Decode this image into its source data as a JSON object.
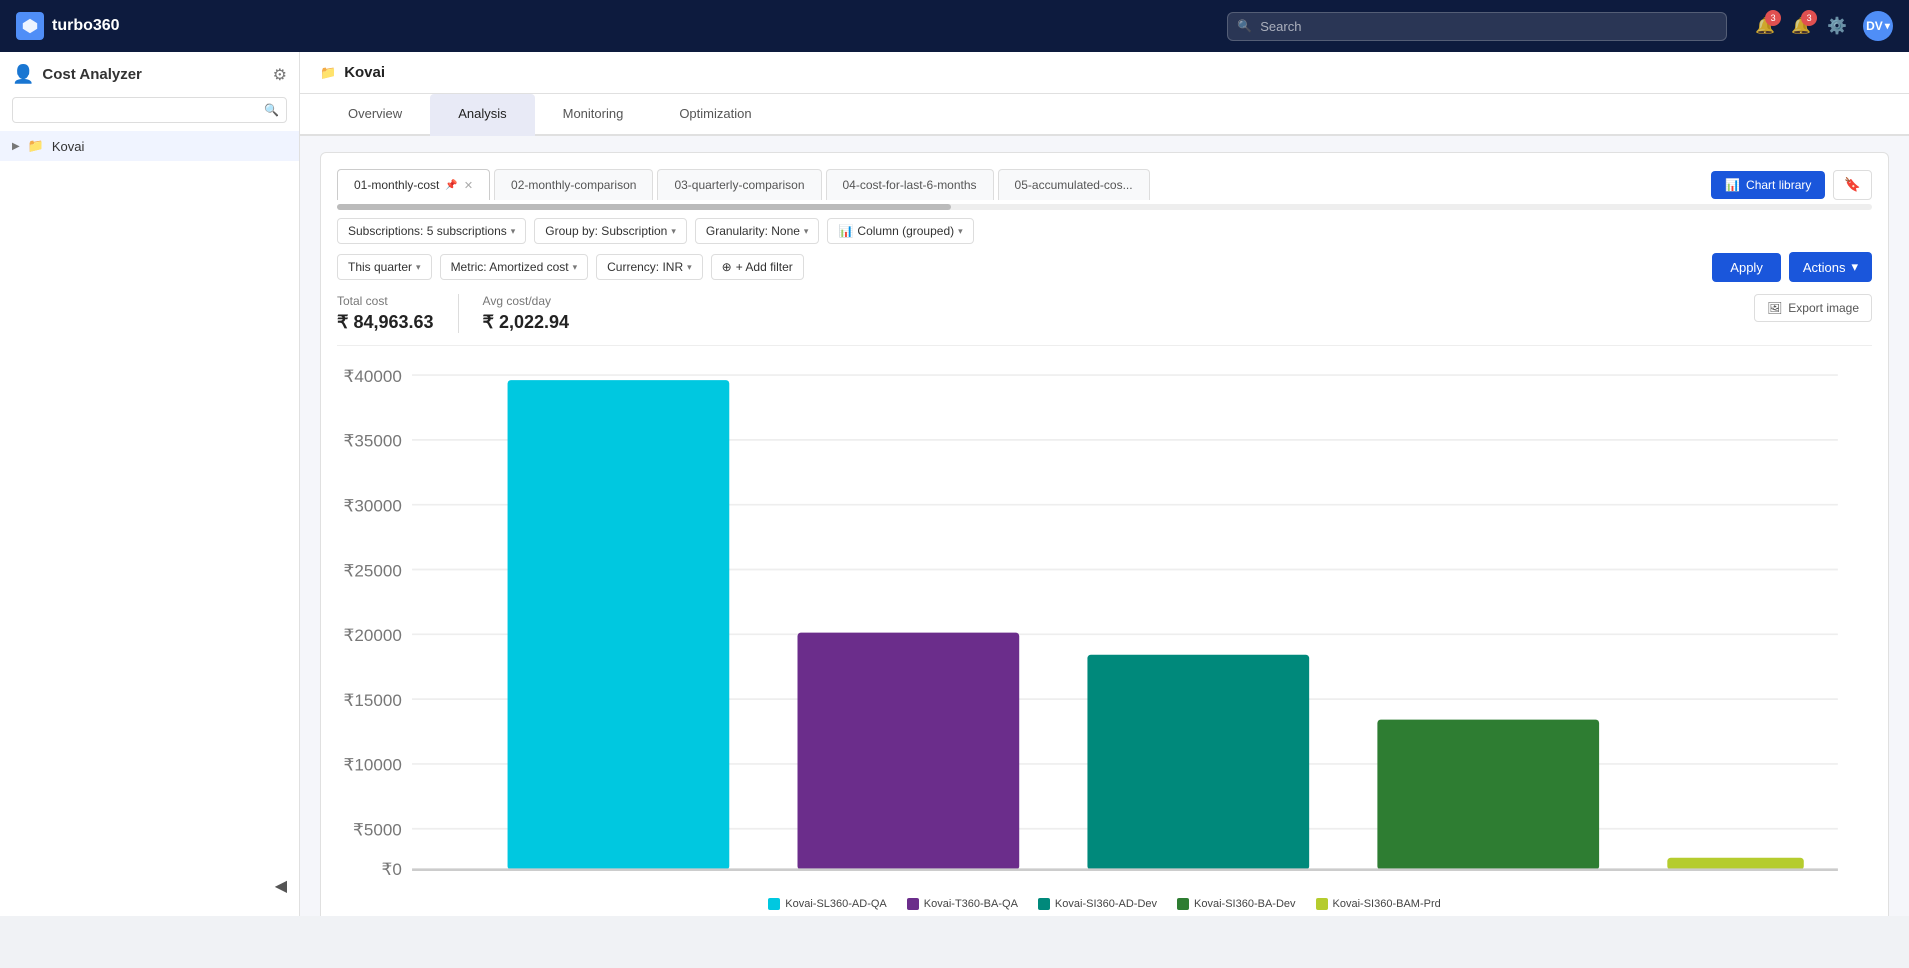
{
  "app": {
    "name": "turbo360",
    "logo_letter": "T"
  },
  "navbar": {
    "search_placeholder": "Search",
    "notifications_count": "3",
    "alerts_count": "3",
    "user_initials": "DV"
  },
  "sidebar": {
    "title": "Cost Analyzer",
    "search_placeholder": "",
    "items": [
      {
        "label": "Kovai",
        "icon": "folder",
        "active": true
      }
    ],
    "collapse_tooltip": "Collapse"
  },
  "breadcrumb": {
    "icon": "folder",
    "text": "Kovai"
  },
  "tabs": [
    {
      "label": "Overview",
      "active": false
    },
    {
      "label": "Analysis",
      "active": true
    },
    {
      "label": "Monitoring",
      "active": false
    },
    {
      "label": "Optimization",
      "active": false
    }
  ],
  "chart_tabs": [
    {
      "label": "01-monthly-cost",
      "pinned": true,
      "closable": true,
      "active": true
    },
    {
      "label": "02-monthly-comparison",
      "pinned": false,
      "closable": false,
      "active": false
    },
    {
      "label": "03-quarterly-comparison",
      "pinned": false,
      "closable": false,
      "active": false
    },
    {
      "label": "04-cost-for-last-6-months",
      "pinned": false,
      "closable": false,
      "active": false
    },
    {
      "label": "05-accumulated-cos...",
      "pinned": false,
      "closable": false,
      "active": false
    }
  ],
  "buttons": {
    "chart_library": "Chart library",
    "apply": "Apply",
    "actions": "Actions",
    "export_image": "Export image"
  },
  "filters": {
    "row1": [
      {
        "label": "Subscriptions: 5 subscriptions"
      },
      {
        "label": "Group by: Subscription"
      },
      {
        "label": "Granularity: None"
      },
      {
        "label": "Column (grouped)",
        "chart_icon": true
      }
    ],
    "row2": [
      {
        "label": "This quarter"
      },
      {
        "label": "Metric: Amortized cost"
      },
      {
        "label": "Currency: INR"
      },
      {
        "label": "+ Add filter"
      }
    ]
  },
  "stats": {
    "total_cost_label": "Total cost",
    "total_cost_value": "₹ 84,963.63",
    "avg_cost_label": "Avg cost/day",
    "avg_cost_value": "₹ 2,022.94"
  },
  "chart": {
    "y_labels": [
      "₹40000",
      "₹35000",
      "₹30000",
      "₹25000",
      "₹20000",
      "₹15000",
      "₹10000",
      "₹5000",
      "₹0"
    ],
    "bars": [
      {
        "label": "Kovai-SL360-AD-QA",
        "color": "#00c8e0",
        "value": 38000,
        "pct": 95
      },
      {
        "label": "Kovai-T360-BA-QA",
        "color": "#6b2d8b",
        "value": 17000,
        "pct": 42
      },
      {
        "label": "Kovai-SI360-AD-Dev",
        "color": "#00897b",
        "value": 15500,
        "pct": 38
      },
      {
        "label": "Kovai-SI360-BA-Dev",
        "color": "#2e7d32",
        "value": 11000,
        "pct": 27
      },
      {
        "label": "Kovai-SI360-BAM-Prd",
        "color": "#b5cc2e",
        "value": 800,
        "pct": 2
      }
    ]
  }
}
